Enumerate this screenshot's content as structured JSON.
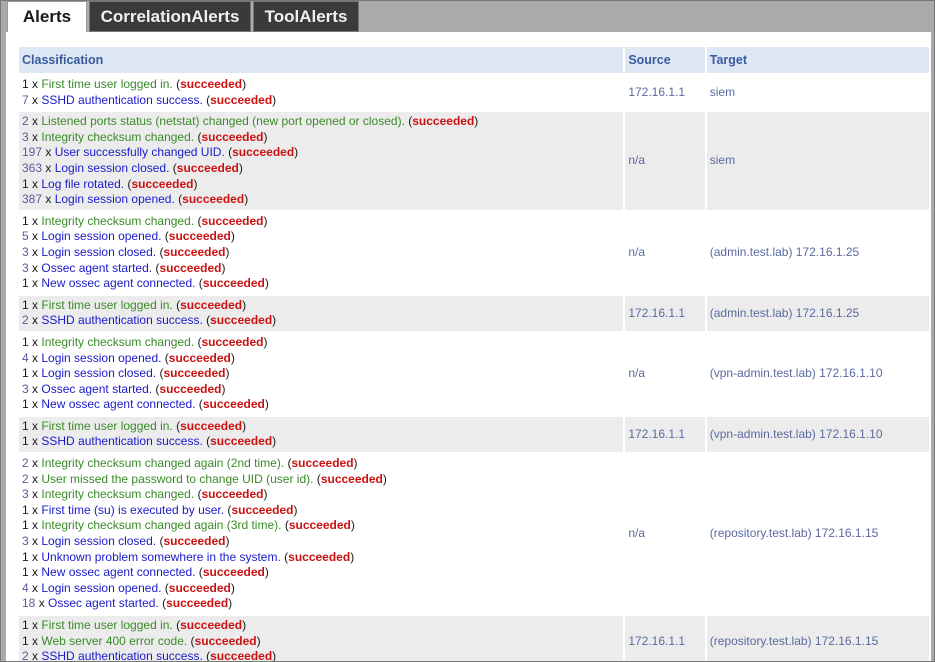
{
  "tabs": [
    {
      "label": "Alerts",
      "active": true
    },
    {
      "label": "CorrelationAlerts",
      "active": false
    },
    {
      "label": "ToolAlerts",
      "active": false
    }
  ],
  "table": {
    "headers": {
      "classification": "Classification",
      "source": "Source",
      "target": "Target"
    },
    "status_text": "succeeded",
    "groups": [
      {
        "source": "172.16.1.1",
        "target": "siem",
        "alerts": [
          {
            "count": "1",
            "count_linked": false,
            "text": "First time user logged in.",
            "color": "green"
          },
          {
            "count": "7",
            "count_linked": true,
            "text": "SSHD authentication success.",
            "color": "blue"
          }
        ]
      },
      {
        "source": "n/a",
        "target": "siem",
        "alerts": [
          {
            "count": "2",
            "count_linked": true,
            "text": "Listened ports status (netstat) changed (new port opened or closed).",
            "color": "green"
          },
          {
            "count": "3",
            "count_linked": true,
            "text": "Integrity checksum changed.",
            "color": "green"
          },
          {
            "count": "197",
            "count_linked": true,
            "text": "User successfully changed UID.",
            "color": "blue"
          },
          {
            "count": "363",
            "count_linked": true,
            "text": "Login session closed.",
            "color": "blue"
          },
          {
            "count": "1",
            "count_linked": false,
            "text": "Log file rotated.",
            "color": "blue"
          },
          {
            "count": "387",
            "count_linked": true,
            "text": "Login session opened.",
            "color": "blue"
          }
        ]
      },
      {
        "source": "n/a",
        "target": "(admin.test.lab) 172.16.1.25",
        "alerts": [
          {
            "count": "1",
            "count_linked": false,
            "text": "Integrity checksum changed.",
            "color": "green"
          },
          {
            "count": "5",
            "count_linked": true,
            "text": "Login session opened.",
            "color": "blue"
          },
          {
            "count": "3",
            "count_linked": true,
            "text": "Login session closed.",
            "color": "blue"
          },
          {
            "count": "3",
            "count_linked": true,
            "text": "Ossec agent started.",
            "color": "blue"
          },
          {
            "count": "1",
            "count_linked": false,
            "text": "New ossec agent connected.",
            "color": "blue"
          }
        ]
      },
      {
        "source": "172.16.1.1",
        "target": "(admin.test.lab) 172.16.1.25",
        "alerts": [
          {
            "count": "1",
            "count_linked": false,
            "text": "First time user logged in.",
            "color": "green"
          },
          {
            "count": "2",
            "count_linked": true,
            "text": "SSHD authentication success.",
            "color": "blue"
          }
        ]
      },
      {
        "source": "n/a",
        "target": "(vpn-admin.test.lab) 172.16.1.10",
        "alerts": [
          {
            "count": "1",
            "count_linked": false,
            "text": "Integrity checksum changed.",
            "color": "green"
          },
          {
            "count": "4",
            "count_linked": true,
            "text": "Login session opened.",
            "color": "blue"
          },
          {
            "count": "1",
            "count_linked": false,
            "text": "Login session closed.",
            "color": "blue"
          },
          {
            "count": "3",
            "count_linked": true,
            "text": "Ossec agent started.",
            "color": "blue"
          },
          {
            "count": "1",
            "count_linked": false,
            "text": "New ossec agent connected.",
            "color": "blue"
          }
        ]
      },
      {
        "source": "172.16.1.1",
        "target": "(vpn-admin.test.lab) 172.16.1.10",
        "alerts": [
          {
            "count": "1",
            "count_linked": false,
            "text": "First time user logged in.",
            "color": "green"
          },
          {
            "count": "1",
            "count_linked": false,
            "text": "SSHD authentication success.",
            "color": "blue"
          }
        ]
      },
      {
        "source": "n/a",
        "target": "(repository.test.lab) 172.16.1.15",
        "alerts": [
          {
            "count": "2",
            "count_linked": true,
            "text": "Integrity checksum changed again (2nd time).",
            "color": "green"
          },
          {
            "count": "2",
            "count_linked": true,
            "text": "User missed the password to change UID (user id).",
            "color": "green"
          },
          {
            "count": "3",
            "count_linked": true,
            "text": "Integrity checksum changed.",
            "color": "green"
          },
          {
            "count": "1",
            "count_linked": false,
            "text": "First time (su) is executed by user.",
            "color": "blue"
          },
          {
            "count": "1",
            "count_linked": false,
            "text": "Integrity checksum changed again (3rd time).",
            "color": "green"
          },
          {
            "count": "3",
            "count_linked": true,
            "text": "Login session closed.",
            "color": "blue"
          },
          {
            "count": "1",
            "count_linked": false,
            "text": "Unknown problem somewhere in the system.",
            "color": "blue"
          },
          {
            "count": "1",
            "count_linked": false,
            "text": "New ossec agent connected.",
            "color": "blue"
          },
          {
            "count": "4",
            "count_linked": true,
            "text": "Login session opened.",
            "color": "blue"
          },
          {
            "count": "18",
            "count_linked": true,
            "text": "Ossec agent started.",
            "color": "blue"
          }
        ]
      },
      {
        "source": "172.16.1.1",
        "target": "(repository.test.lab) 172.16.1.15",
        "alerts": [
          {
            "count": "1",
            "count_linked": false,
            "text": "First time user logged in.",
            "color": "green"
          },
          {
            "count": "1",
            "count_linked": false,
            "text": "Web server 400 error code.",
            "color": "green"
          },
          {
            "count": "2",
            "count_linked": true,
            "text": "SSHD authentication success.",
            "color": "blue"
          }
        ]
      }
    ]
  }
}
